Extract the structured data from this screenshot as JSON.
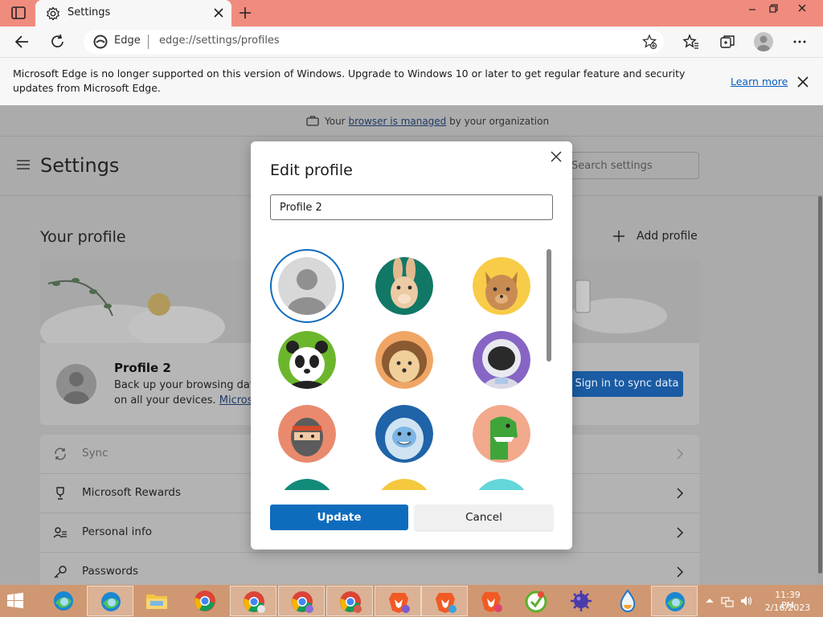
{
  "window": {
    "tab_title": "Settings",
    "address_brand": "Edge",
    "address_url": "edge://settings/profiles"
  },
  "notice": {
    "text": "Microsoft Edge is no longer supported on this version of Windows. Upgrade to Windows 10 or later to get regular feature and security updates from Microsoft Edge.",
    "link": "Learn more"
  },
  "managed": {
    "prefix": "Your",
    "link": "browser is managed",
    "suffix": "by your organization"
  },
  "settings": {
    "title": "Settings",
    "search_placeholder": "Search settings",
    "section_title": "Your profile",
    "add_profile": "Add profile"
  },
  "profile_card": {
    "name": "Profile 2",
    "desc_line1": "Back up your browsing data",
    "desc_line2_prefix": "on all your devices.",
    "desc_line2_link": "Microso",
    "sync_button": "Sign in to sync data"
  },
  "settings_list": [
    {
      "label": "Sync",
      "icon": "sync-icon"
    },
    {
      "label": "Microsoft Rewards",
      "icon": "trophy-icon"
    },
    {
      "label": "Personal info",
      "icon": "person-card-icon"
    },
    {
      "label": "Passwords",
      "icon": "key-icon"
    }
  ],
  "modal": {
    "title": "Edit profile",
    "input_value": "Profile 2",
    "update_label": "Update",
    "cancel_label": "Cancel",
    "avatars": [
      "default-avatar",
      "rabbit-avatar",
      "cat-avatar",
      "panda-avatar",
      "hedgehog-avatar",
      "astronaut-avatar",
      "ninja-avatar",
      "yeti-avatar",
      "dinosaur-avatar"
    ]
  },
  "taskbar": {
    "time": "11:39 PM",
    "date": "2/16/2023"
  },
  "colors": {
    "accent": "#0f6cbd",
    "titlebar": "#f08c7e",
    "taskbar": "#cf9872"
  }
}
